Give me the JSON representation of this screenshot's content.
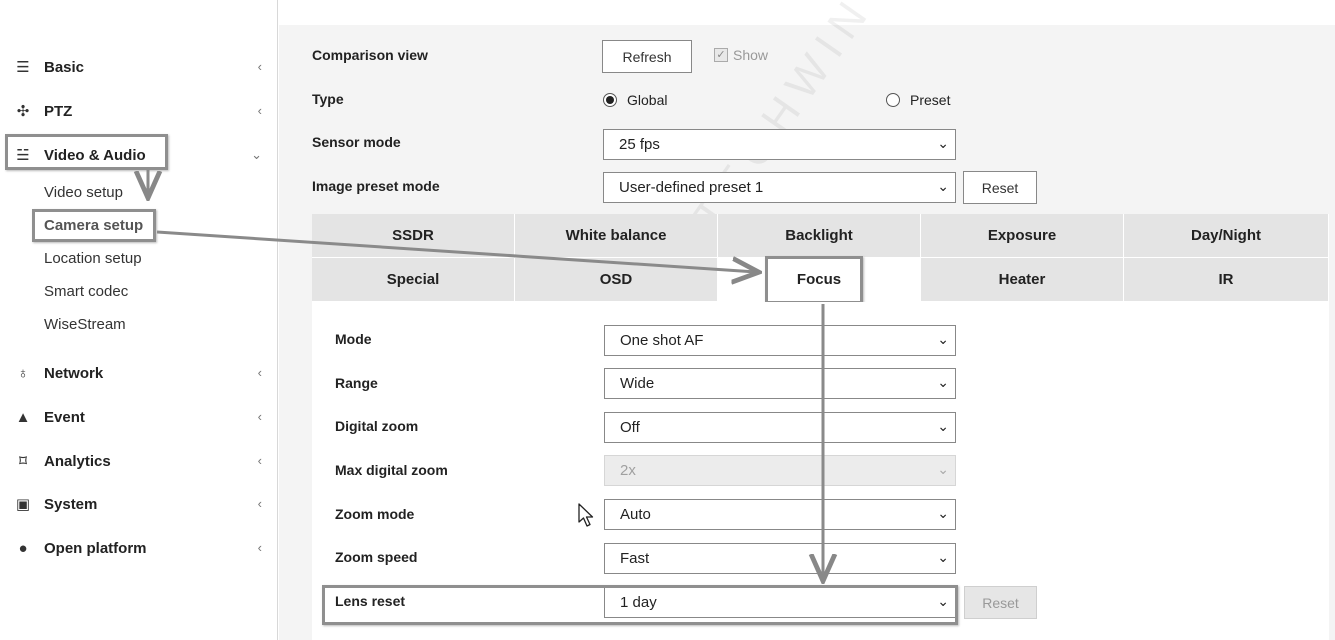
{
  "sidebar": {
    "items": [
      {
        "label": "Basic",
        "icon": "list-icon",
        "glyph": "☰",
        "chevron": "‹"
      },
      {
        "label": "PTZ",
        "icon": "move-icon",
        "glyph": "✣",
        "chevron": "‹"
      },
      {
        "label": "Video & Audio",
        "icon": "sliders-icon",
        "glyph": "☱",
        "chevron": "⌄"
      },
      {
        "label": "Network",
        "icon": "network-icon",
        "glyph": "♁",
        "chevron": "‹"
      },
      {
        "label": "Event",
        "icon": "bell-icon",
        "glyph": "▲",
        "chevron": "‹"
      },
      {
        "label": "Analytics",
        "icon": "analytics-icon",
        "glyph": "⌑",
        "chevron": "‹"
      },
      {
        "label": "System",
        "icon": "system-icon",
        "glyph": "▣",
        "chevron": "‹"
      },
      {
        "label": "Open platform",
        "icon": "platform-icon",
        "glyph": "●",
        "chevron": "‹"
      }
    ],
    "sub_items": [
      "Video setup",
      "Camera setup",
      "Location setup",
      "Smart codec",
      "WiseStream"
    ]
  },
  "top": {
    "comparison_view": {
      "label": "Comparison view",
      "refresh": "Refresh",
      "show": "Show"
    },
    "type": {
      "label": "Type",
      "global": "Global",
      "preset": "Preset"
    },
    "sensor_mode": {
      "label": "Sensor mode",
      "value": "25 fps"
    },
    "image_preset_mode": {
      "label": "Image preset mode",
      "value": "User-defined preset 1",
      "reset": "Reset"
    }
  },
  "tabs": {
    "row1": [
      "SSDR",
      "White balance",
      "Backlight",
      "Exposure",
      "Day/Night"
    ],
    "row2": [
      "Special",
      "OSD",
      "Focus",
      "Heater",
      "IR"
    ],
    "active": "Focus"
  },
  "focus": {
    "mode": {
      "label": "Mode",
      "value": "One shot AF"
    },
    "range": {
      "label": "Range",
      "value": "Wide"
    },
    "digital_zoom": {
      "label": "Digital zoom",
      "value": "Off"
    },
    "max_digital_zoom": {
      "label": "Max digital zoom",
      "value": "2x"
    },
    "zoom_mode": {
      "label": "Zoom mode",
      "value": "Auto"
    },
    "zoom_speed": {
      "label": "Zoom speed",
      "value": "Fast"
    },
    "lens_reset": {
      "label": "Lens reset",
      "value": "1 day",
      "reset": "Reset"
    }
  },
  "watermark": "HANWHA TECHWIN",
  "colors": {
    "highlight": "#8f8f8f",
    "tab_bg": "#e4e4e4",
    "main_bg": "#f4f4f4"
  }
}
